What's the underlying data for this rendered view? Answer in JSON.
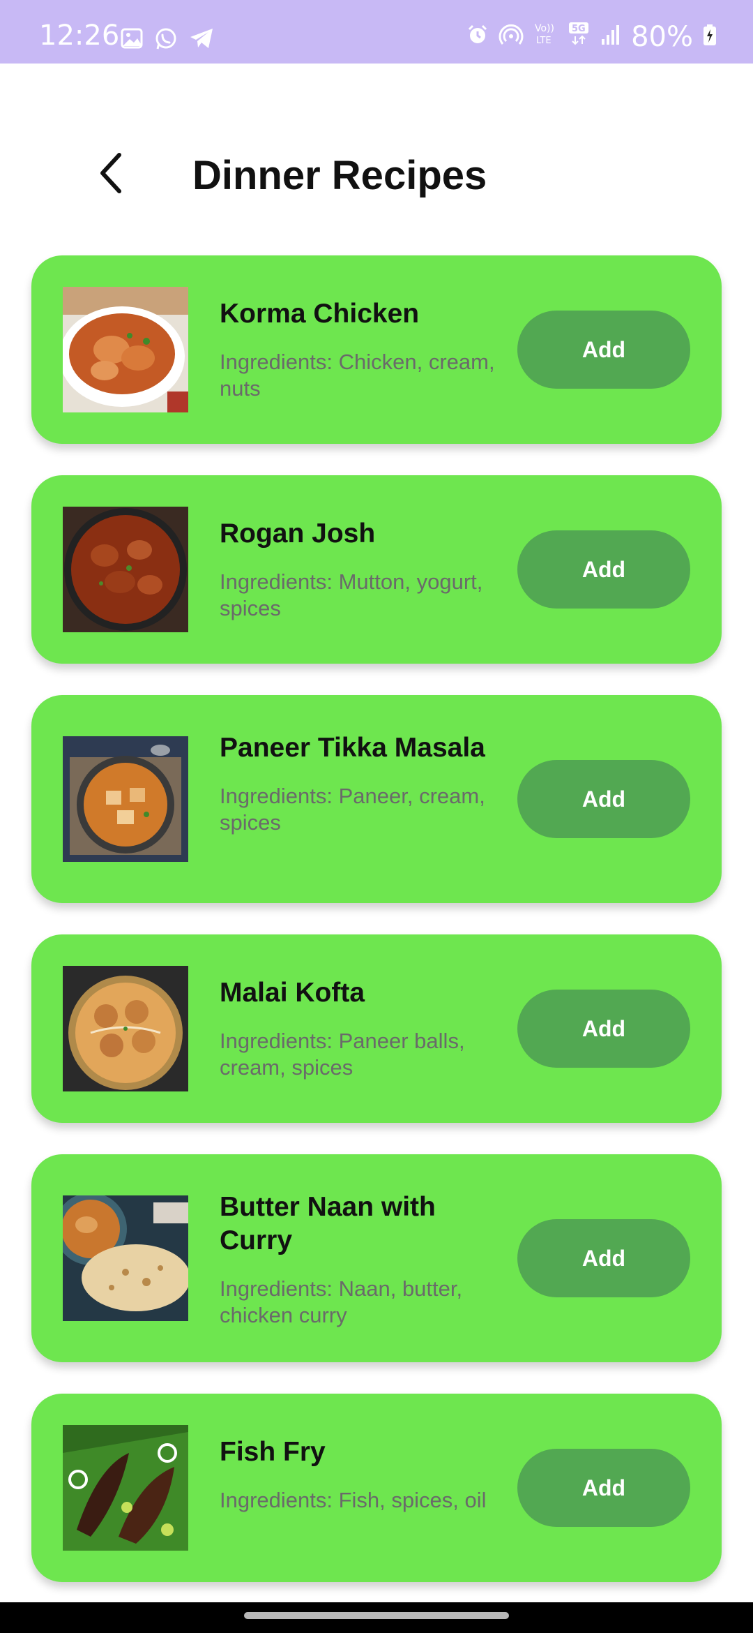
{
  "status_bar": {
    "time": "12:26",
    "battery": "80%",
    "left_icons": [
      "image-icon",
      "whatsapp-icon",
      "telegram-icon"
    ],
    "right_icons": [
      "alarm-icon",
      "hotspot-icon",
      "volte-icon",
      "5g-icon",
      "signal-icon",
      "battery-icon"
    ],
    "background": "#c8b9f5"
  },
  "header": {
    "title": "Dinner Recipes",
    "back_icon": "chevron-left-icon"
  },
  "colors": {
    "card": "#6ee64f",
    "button": "#52a852"
  },
  "recipes": [
    {
      "name": "Korma Chicken",
      "ingredients": "Ingredients: Chicken, cream, nuts",
      "button": "Add"
    },
    {
      "name": "Rogan Josh",
      "ingredients": "Ingredients: Mutton, yogurt, spices",
      "button": "Add"
    },
    {
      "name": "Paneer Tikka Masala",
      "ingredients": "Ingredients: Paneer, cream, spices",
      "button": "Add"
    },
    {
      "name": "Malai Kofta",
      "ingredients": "Ingredients: Paneer balls, cream, spices",
      "button": "Add"
    },
    {
      "name": "Butter Naan with Curry",
      "ingredients": "Ingredients: Naan, butter, chicken curry",
      "button": "Add"
    },
    {
      "name": "Fish Fry",
      "ingredients": "Ingredients: Fish, spices, oil",
      "button": "Add"
    }
  ]
}
